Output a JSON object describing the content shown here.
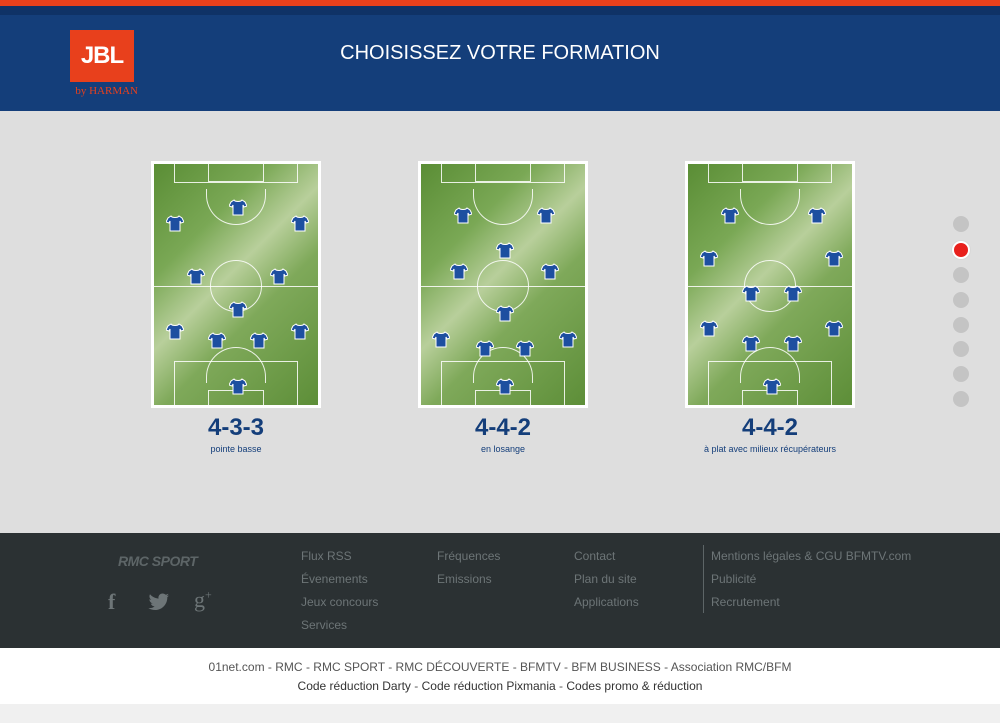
{
  "header": {
    "logo_text": "JBL",
    "logo_sub": "by HARMAN",
    "title": "CHOISISSEZ VOTRE FORMATION"
  },
  "formations": [
    {
      "label": "4-3-3",
      "desc": "pointe basse"
    },
    {
      "label": "4-4-2",
      "desc": "en losange"
    },
    {
      "label": "4-4-2",
      "desc": "à plat avec milieux récupérateurs"
    }
  ],
  "pagination": {
    "total": 8,
    "active_index": 1
  },
  "footer": {
    "brand": "RMC SPORT",
    "social": [
      "facebook-icon",
      "twitter-icon",
      "google-plus-icon"
    ],
    "col1": [
      "Flux RSS",
      "Évenements",
      "Jeux concours",
      "Services"
    ],
    "col2": [
      "Fréquences",
      "Emissions"
    ],
    "col3": [
      "Contact",
      "Plan du site",
      "Applications"
    ],
    "col4": [
      "Mentions légales & CGU BFMTV.com",
      "Publicité",
      "Recrutement"
    ]
  },
  "bottom_links": {
    "row1": [
      "01net.com",
      "RMC",
      "RMC SPORT",
      "RMC DÉCOUVERTE",
      "BFMTV",
      "BFM BUSINESS",
      "Association RMC/BFM"
    ],
    "row2": [
      "Code réduction Darty",
      "Code réduction Pixmania",
      "Codes promo & réduction"
    ]
  },
  "colors": {
    "accent": "#e8401c",
    "header_bg": "#143e7a",
    "footer_bg": "#2b3133",
    "active_dot": "#e8201c",
    "jersey": "#1d4fa0"
  }
}
